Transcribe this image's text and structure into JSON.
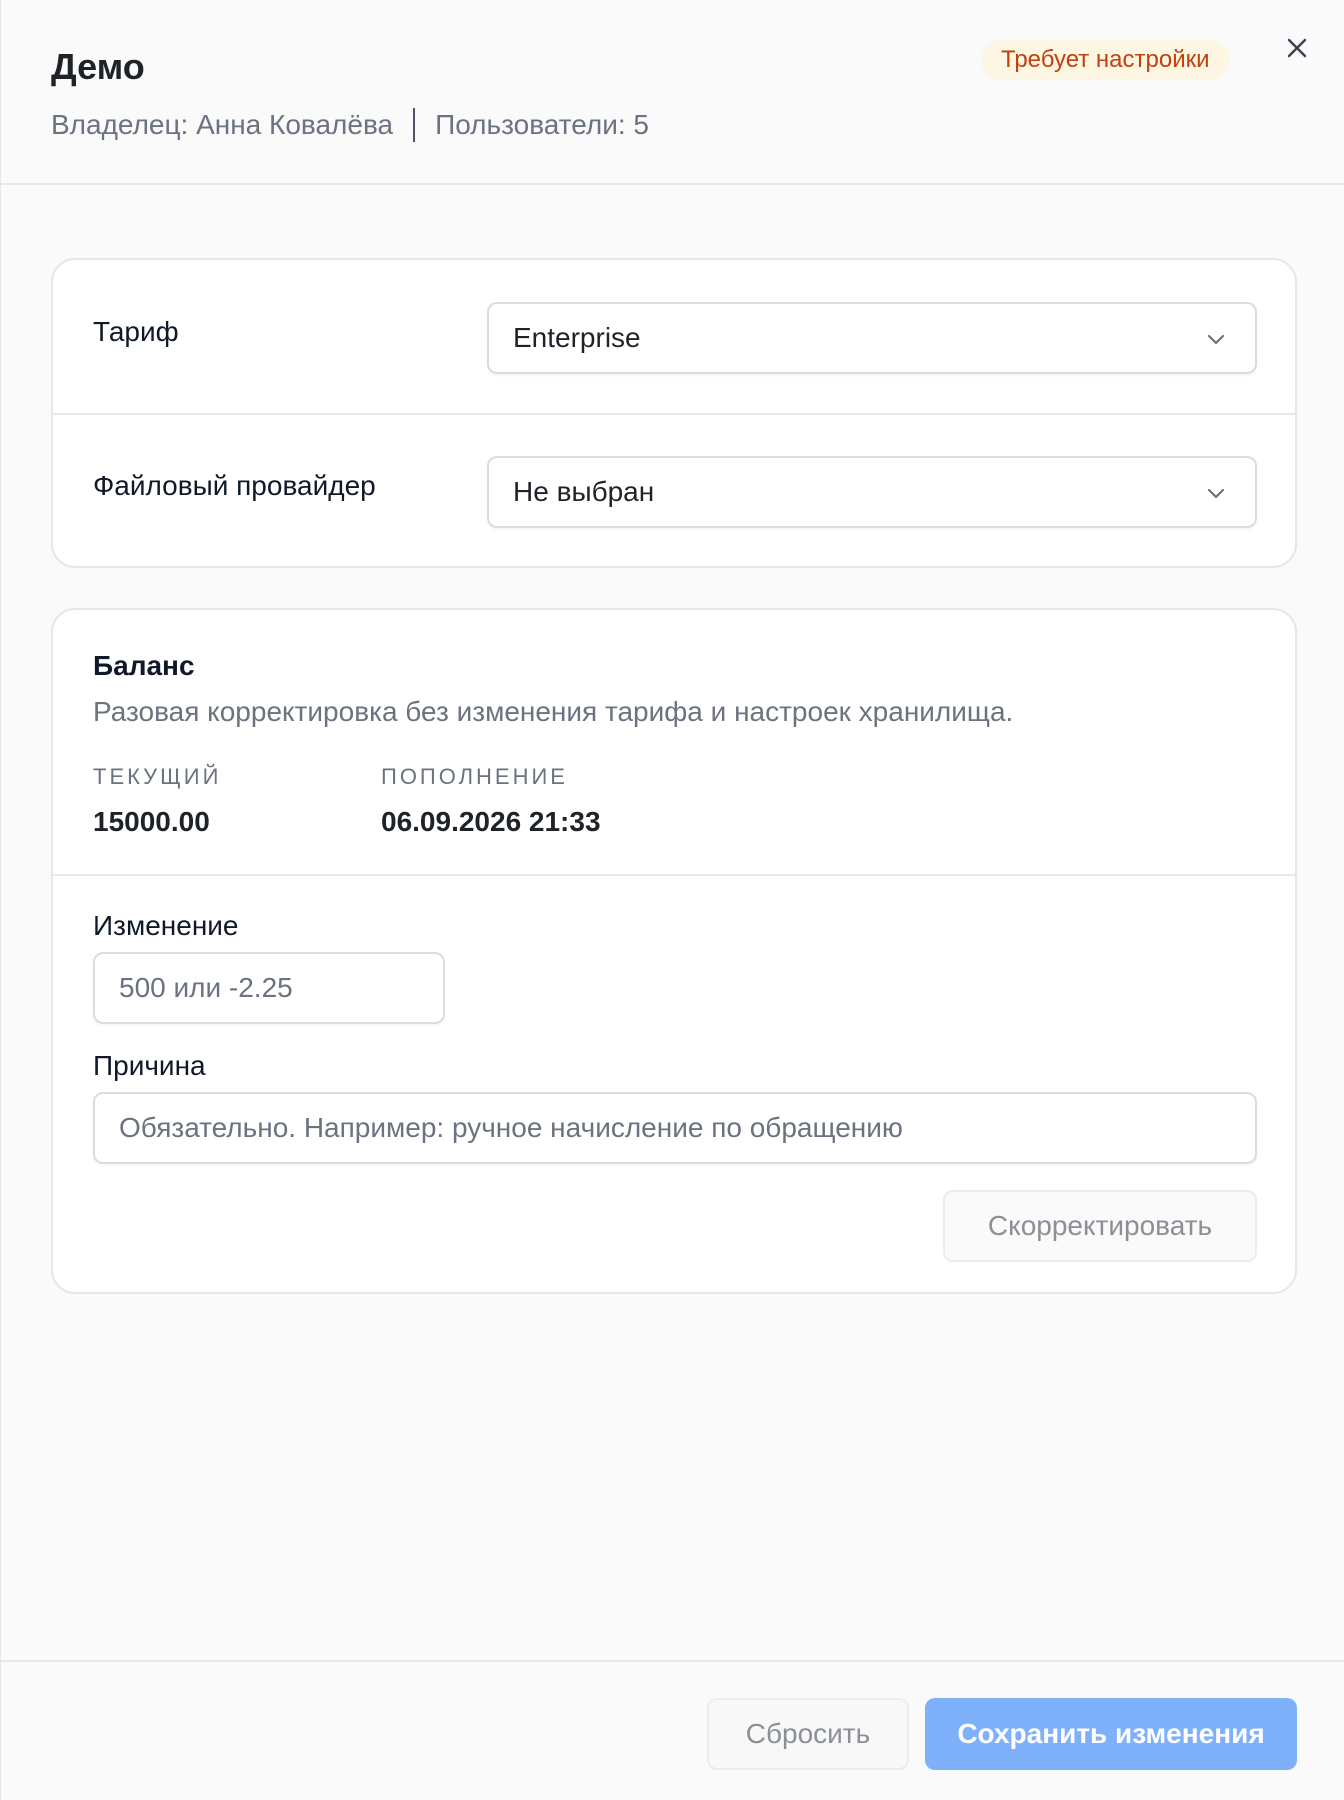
{
  "header": {
    "title": "Демо",
    "owner": "Владелец: Анна Ковалёва",
    "users": "Пользователи: 5",
    "status_badge": "Требует настройки",
    "close_icon": "close-icon"
  },
  "settings": {
    "tariff_label": "Тариф",
    "tariff_value": "Enterprise",
    "provider_label": "Файловый провайдер",
    "provider_value": "Не выбран",
    "chevron_icon": "chevron-down-icon"
  },
  "balance": {
    "title": "Баланс",
    "description": "Разовая корректировка без изменения тарифа и настроек хранилища.",
    "current_label": "ТЕКУЩИЙ",
    "current_value": "15000.00",
    "topup_label": "ПОПОЛНЕНИЕ",
    "topup_value": "06.09.2026 21:33",
    "change_label": "Изменение",
    "change_placeholder": "500 или -2.25",
    "reason_label": "Причина",
    "reason_placeholder": "Обязательно. Например: ручное начисление по обращению",
    "adjust_button": "Скорректировать"
  },
  "footer": {
    "reset_button": "Сбросить",
    "save_button": "Сохранить изменения"
  },
  "colors": {
    "badge_bg": "#fdf6e3",
    "badge_text": "#c2410c",
    "primary": "#7fb1fb"
  }
}
